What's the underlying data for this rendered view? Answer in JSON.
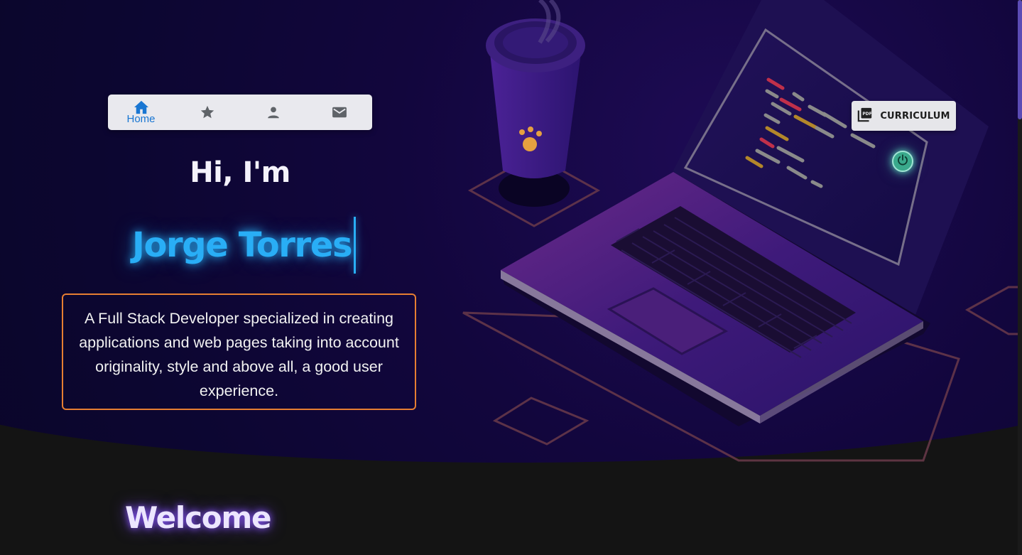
{
  "nav": {
    "items": [
      {
        "icon": "home-icon",
        "label": "Home",
        "active": true
      },
      {
        "icon": "star-icon",
        "label": "",
        "active": false
      },
      {
        "icon": "person-icon",
        "label": "",
        "active": false
      },
      {
        "icon": "mail-icon",
        "label": "",
        "active": false
      }
    ]
  },
  "hero": {
    "greeting": "Hi, I'm",
    "name": "Jorge Torres",
    "bio": "A  Full Stack Developer specialized in creating applications and web pages taking into account originality, style and above all, a good user experience."
  },
  "curriculum": {
    "label": "CURRICULUM",
    "icon": "pdf-icon"
  },
  "power": {
    "icon": "power-icon"
  },
  "section": {
    "title": "Welcome"
  },
  "colors": {
    "accent_blue": "#29aef6",
    "bio_border": "#e67e32",
    "nav_active": "#1976d2",
    "hero_bg": "#0c0631",
    "welcome_glow": "#8c5aff"
  }
}
